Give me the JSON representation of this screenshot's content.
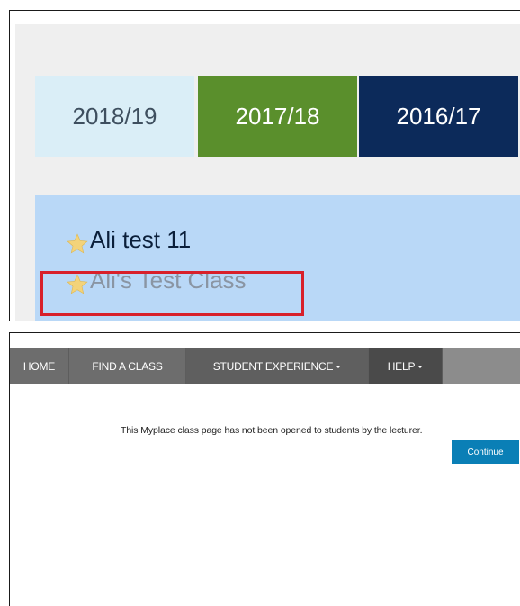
{
  "top_panel": {
    "year_tabs": [
      {
        "label": "2018/19",
        "color": "#daeef7"
      },
      {
        "label": "2017/18",
        "color": "#5a8f2c"
      },
      {
        "label": "2016/17",
        "color": "#0c2a5a"
      }
    ],
    "classes": [
      {
        "label": "Ali test 11",
        "icon": "star-icon"
      },
      {
        "label": "Ali's Test Class",
        "icon": "star-icon",
        "highlighted": true
      }
    ],
    "highlight_color": "#d8202a"
  },
  "bottom_panel": {
    "nav": {
      "home": "HOME",
      "find_class": "FIND A CLASS",
      "student_experience": "STUDENT EXPERIENCE",
      "help": "HELP"
    },
    "message": "This Myplace class page has not been opened to students by the lecturer.",
    "continue_label": "Continue",
    "accent": "#0a7fb6"
  }
}
